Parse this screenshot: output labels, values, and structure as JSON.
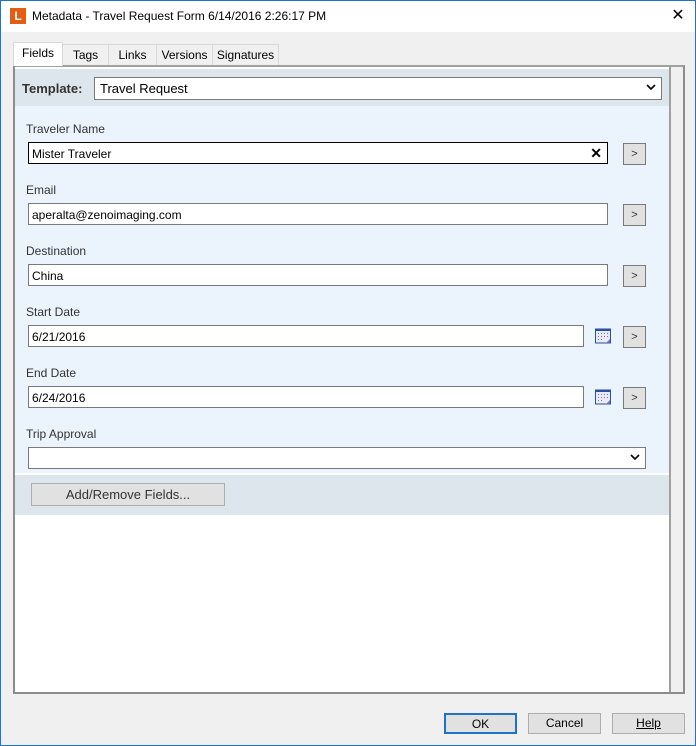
{
  "window": {
    "title": "Metadata - Travel Request Form 6/14/2016 2:26:17 PM",
    "logo_letter": "L",
    "close_label": "✕"
  },
  "tabs": [
    {
      "label": "Fields",
      "active": true
    },
    {
      "label": "Tags"
    },
    {
      "label": "Links"
    },
    {
      "label": "Versions"
    },
    {
      "label": "Signatures"
    }
  ],
  "template": {
    "label": "Template:",
    "value": "Travel Request"
  },
  "fields": [
    {
      "label": "Traveler Name",
      "value": "Mister Traveler",
      "go": ">",
      "clear": "✕"
    },
    {
      "label": "Email",
      "value": "aperalta@zenoimaging.com",
      "go": ">"
    },
    {
      "label": "Destination",
      "value": "China",
      "go": ">"
    },
    {
      "label": "Start Date",
      "value": "6/21/2016",
      "go": ">"
    },
    {
      "label": "End Date",
      "value": "6/24/2016",
      "go": ">"
    },
    {
      "label": "Trip Approval",
      "value": ""
    }
  ],
  "add_remove_label": "Add/Remove Fields...",
  "buttons": {
    "ok": "OK",
    "cancel": "Cancel",
    "help": "Help"
  },
  "colors": {
    "accent": "#1e73c8",
    "logo": "#e35d12",
    "field_bg": "#ebf3fd",
    "band_bg": "#dde6ed"
  }
}
